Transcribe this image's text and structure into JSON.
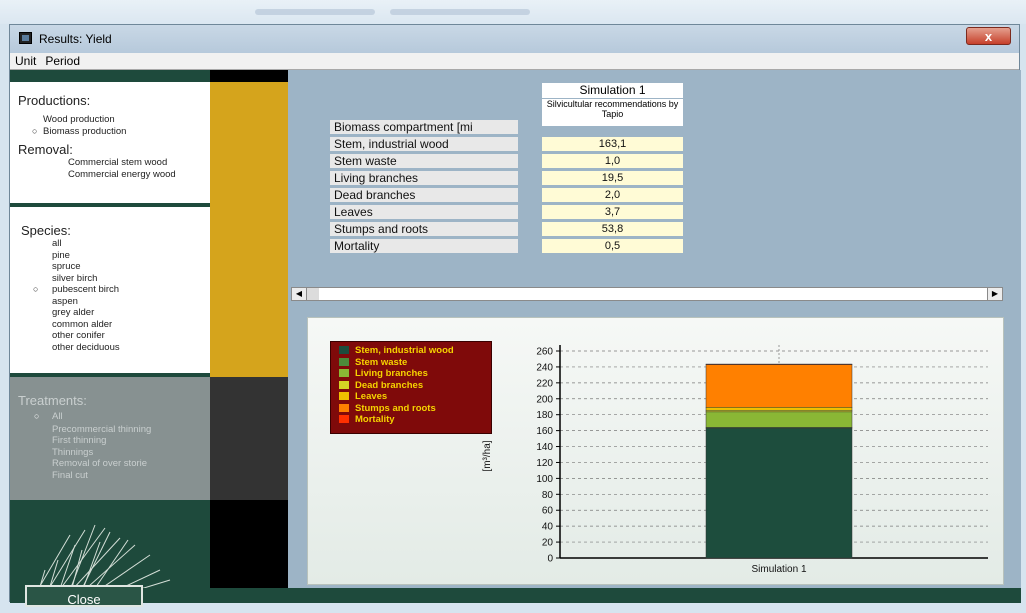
{
  "window": {
    "title": "Results: Yield",
    "close_label": "x"
  },
  "menu": [
    "Unit",
    "Period"
  ],
  "productions": {
    "header": "Productions:",
    "options": [
      "Wood production",
      "Biomass production"
    ],
    "selected": "Biomass production",
    "removal_header": "Removal:",
    "removal_items": [
      "Commercial stem wood",
      "Commercial energy wood"
    ]
  },
  "species": {
    "header": "Species:",
    "options": [
      "all",
      "pine",
      "spruce",
      "silver birch",
      "pubescent birch",
      "aspen",
      "grey alder",
      "common alder",
      "other conifer",
      "other deciduous"
    ],
    "selected": "pubescent birch"
  },
  "treatments": {
    "header": "Treatments:",
    "options": [
      "All",
      "Precommercial thinning",
      "First thinning",
      "Thinnings",
      "Removal of over storie",
      "Final cut"
    ],
    "selected": "All"
  },
  "table": {
    "col_header": "Simulation 1",
    "col_subheader": "Silvicultular recommendations by Tapio",
    "row_header": "Biomass compartment [mi",
    "rows": [
      {
        "label": "Stem, industrial wood",
        "value": "163,1"
      },
      {
        "label": "Stem waste",
        "value": "1,0"
      },
      {
        "label": "Living branches",
        "value": "19,5"
      },
      {
        "label": "Dead branches",
        "value": "2,0"
      },
      {
        "label": "Leaves",
        "value": "3,7"
      },
      {
        "label": "Stumps and roots",
        "value": "53,8"
      },
      {
        "label": "Mortality",
        "value": "0,5"
      }
    ]
  },
  "chart_data": {
    "type": "bar",
    "stacked": true,
    "categories": [
      "Simulation 1"
    ],
    "ylabel": "[m³/ha]",
    "ylim": [
      0,
      260
    ],
    "yticks": [
      "0",
      "20",
      "40",
      "60",
      "80",
      "100",
      "120",
      "140",
      "160",
      "180",
      "200",
      "220",
      "240",
      "260"
    ],
    "grid": true,
    "legend_position": "top-left",
    "series": [
      {
        "name": "Stem, industrial wood",
        "values": [
          163.1
        ],
        "color": "#1d4d3d"
      },
      {
        "name": "Stem waste",
        "values": [
          1.0
        ],
        "color": "#4d8a3a"
      },
      {
        "name": "Living branches",
        "values": [
          19.5
        ],
        "color": "#8ab735"
      },
      {
        "name": "Dead branches",
        "values": [
          2.0
        ],
        "color": "#d4d424"
      },
      {
        "name": "Leaves",
        "values": [
          3.7
        ],
        "color": "#f0c000"
      },
      {
        "name": "Stumps and roots",
        "values": [
          53.8
        ],
        "color": "#ff8000"
      },
      {
        "name": "Mortality",
        "values": [
          0.5
        ],
        "color": "#ff3000"
      }
    ]
  },
  "buttons": {
    "close": "Close"
  },
  "colors": {
    "panel_dark": "#1e4a3c",
    "panel_gold": "#d5a41c",
    "legend_bg": "#7f0a0a",
    "window_bg": "#9db4c6"
  }
}
